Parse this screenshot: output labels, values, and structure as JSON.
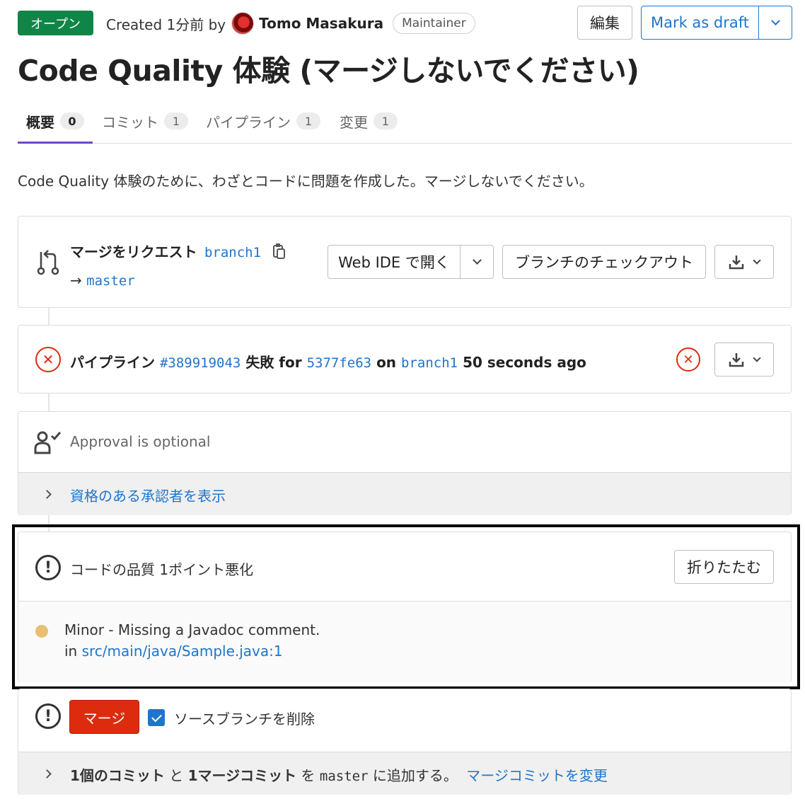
{
  "header": {
    "status": "オープン",
    "created_prefix": "Created 1分前 by",
    "author": "Tomo Masakura",
    "role": "Maintainer",
    "edit_label": "編集",
    "draft_label": "Mark as draft"
  },
  "title": "Code Quality 体験 (マージしないでください)",
  "tabs": [
    {
      "label": "概要",
      "count": "0"
    },
    {
      "label": "コミット",
      "count": "1"
    },
    {
      "label": "パイプライン",
      "count": "1"
    },
    {
      "label": "変更",
      "count": "1"
    }
  ],
  "description": "Code Quality 体験のために、わざとコードに問題を作成した。マージしないでください。",
  "merge_request": {
    "label": "マージをリクエスト",
    "source_branch": "branch1",
    "arrow": "→",
    "target_branch": "master",
    "web_ide_label": "Web IDE で開く",
    "checkout_label": "ブランチのチェックアウト"
  },
  "pipeline": {
    "label": "パイプライン",
    "id": "#389919043",
    "status": "失敗 for",
    "commit": "5377fe63",
    "on": "on",
    "branch": "branch1",
    "time": "50 seconds ago"
  },
  "approval": {
    "text": "Approval is optional",
    "show_approvers": "資格のある承認者を表示"
  },
  "code_quality": {
    "summary": "コードの品質 1ポイント悪化",
    "collapse_label": "折りたたむ",
    "issue": "Minor - Missing a Javadoc comment.",
    "in_label": "in",
    "file": "src/main/java/Sample.java:1",
    "severity_color": "#e9be74"
  },
  "merge": {
    "button_label": "マージ",
    "delete_source_label": "ソースブランチを削除",
    "delete_source_checked": true,
    "commits_count": "1個のコミット",
    "and": "と",
    "merge_commit": "1マージコミット",
    "wo": "を",
    "target": "master",
    "add_text": "に追加する。",
    "change_link": "マージコミットを変更"
  },
  "colors": {
    "open_badge": "#108548",
    "link": "#1f75cb",
    "danger": "#dd2b0e",
    "tab_active": "#6e49cb"
  }
}
